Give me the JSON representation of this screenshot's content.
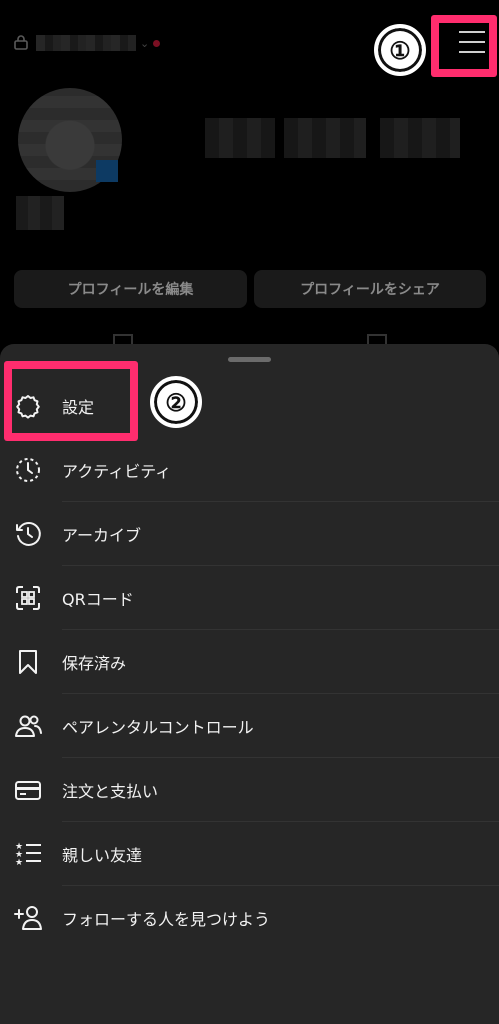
{
  "profile": {
    "edit_button": "プロフィールを編集",
    "share_button": "プロフィールをシェア"
  },
  "annotations": {
    "step1": "①",
    "step2": "②",
    "highlight_color": "#ff2d6e"
  },
  "menu": {
    "items": [
      {
        "label": "設定",
        "icon": "settings-gear-icon"
      },
      {
        "label": "アクティビティ",
        "icon": "activity-clock-icon"
      },
      {
        "label": "アーカイブ",
        "icon": "archive-history-icon"
      },
      {
        "label": "QRコード",
        "icon": "qr-code-icon"
      },
      {
        "label": "保存済み",
        "icon": "bookmark-icon"
      },
      {
        "label": "ペアレンタルコントロール",
        "icon": "parental-control-people-icon"
      },
      {
        "label": "注文と支払い",
        "icon": "credit-card-icon"
      },
      {
        "label": "親しい友達",
        "icon": "close-friends-list-icon"
      },
      {
        "label": "フォローする人を見つけよう",
        "icon": "add-person-icon"
      }
    ]
  },
  "colors": {
    "sheet_bg": "#262626",
    "background": "#000000"
  }
}
